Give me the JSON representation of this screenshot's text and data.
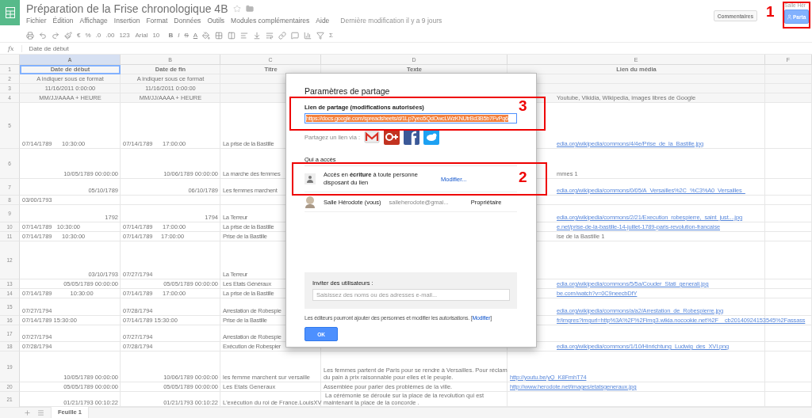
{
  "app": {
    "title": "Préparation de la Frise chronologique 4B",
    "menu": [
      "Fichier",
      "Édition",
      "Affichage",
      "Insertion",
      "Format",
      "Données",
      "Outils",
      "Modules complémentaires",
      "Aide"
    ],
    "last_modified": "Dernière modification il y a 9 jours",
    "user": "Salle Hér",
    "comments_button": "Commentaires",
    "share_button": "Parta"
  },
  "toolbar": [
    {
      "kind": "print"
    },
    {
      "kind": "undo"
    },
    {
      "kind": "redo"
    },
    {
      "kind": "paint"
    },
    {
      "kind": "text",
      "label": "€"
    },
    {
      "kind": "text",
      "label": "%"
    },
    {
      "kind": "text",
      "label": ".0"
    },
    {
      "kind": "text",
      "label": ".00"
    },
    {
      "kind": "menu",
      "label": "123"
    },
    {
      "kind": "menu",
      "label": "Arial"
    },
    {
      "kind": "menu",
      "label": "10"
    },
    {
      "kind": "bold",
      "label": "B"
    },
    {
      "kind": "italic",
      "label": "I"
    },
    {
      "kind": "strike",
      "label": "S"
    },
    {
      "kind": "color",
      "label": "A"
    },
    {
      "kind": "fill"
    },
    {
      "kind": "borders"
    },
    {
      "kind": "merge"
    },
    {
      "kind": "align"
    },
    {
      "kind": "valign"
    },
    {
      "kind": "wrap"
    },
    {
      "kind": "link"
    },
    {
      "kind": "comment"
    },
    {
      "kind": "chart"
    },
    {
      "kind": "filter"
    },
    {
      "kind": "menu",
      "label": "Σ"
    }
  ],
  "formula_bar": {
    "label": "fx",
    "value": "Date de début"
  },
  "grid": {
    "columns": [
      {
        "label": "A",
        "selected": true
      },
      {
        "label": "B",
        "selected": false
      },
      {
        "label": "C",
        "selected": false
      },
      {
        "label": "D",
        "selected": false
      },
      {
        "label": "E",
        "selected": false
      },
      {
        "label": "F",
        "selected": false
      }
    ],
    "rows": [
      {
        "number": "1",
        "a": "Date de début",
        "b": "Date de fin",
        "c": "Titre",
        "d": "Texte",
        "e": "Lien du média"
      },
      {
        "number": "2",
        "a": "A indiquer sous ce format",
        "b": "A indiquer sous ce format"
      },
      {
        "number": "3",
        "a": "11/16/2011 0:00:00",
        "b": "11/16/2011 0:00:00"
      },
      {
        "number": "4",
        "a": "MM/JJ/AAAA + HEURE",
        "b": "MM/JJ/AAAA + HEURE",
        "e": "Youtube, Vikidia, Wikipedia, images libres de Google"
      },
      {
        "number": "5",
        "a": "07/14/1789      10:30:00",
        "b": "07/14/1789      17:00:00",
        "c": "La prise de la Bastille",
        "link": "edia.org/wikipedia/commons/4/4e/Prise_de_la_Bastille.jpg"
      },
      {
        "number": "6",
        "a": "10/05/1789 00:00:00",
        "b": "10/06/1789 00:00:00",
        "c": "La marche des femmes",
        "e": "mmes 1"
      },
      {
        "number": "7",
        "a": "05/10/1789",
        "b": "06/10/1789",
        "c": "Les femmes marchent",
        "link": "edia.org/wikipedia/commons/0/05/A_Versailles%2C_%C3%A0_Versailles_"
      },
      {
        "number": "8",
        "a": "03/00/1793"
      },
      {
        "number": "9",
        "a": "1792",
        "b": "1794",
        "c": "La Terreur",
        "link": "edia.org/wikipedia/commons/2/21/Execution_robespierre,_saint_just....jpg"
      },
      {
        "number": "10",
        "a": "07/14/1789   10:30:00",
        "b": "07/14/1789      17:00:00",
        "c": "La prise de la Bastille",
        "link": "e.net/prise-de-la-bastille-14-juillet-1789-paris-revolution-francaise"
      },
      {
        "number": "11",
        "a": "07/14/1789      10:30:00",
        "b": "07/14/1789     17:00:00",
        "c": "Prise de la Bastille",
        "e": "ise de la Bastille 1"
      },
      {
        "number": "12",
        "a": "03/10/1793",
        "b": "07/27/1794",
        "c": "La Terreur"
      },
      {
        "number": "13",
        "a": "05/05/1789 00:00:00",
        "b": "05/05/1789 00:00:00",
        "c": "Les Etats Généraux",
        "link": "edia.org/wikipedia/commons/5/5a/Couder_Stati_generali.jpg"
      },
      {
        "number": "14",
        "a": "07/14/1789           10:30:00",
        "b": "07/14/1789      17:00:00",
        "c": "La prise de la Bastille",
        "link": "be.com/watch?v=0C9neecbDfY"
      },
      {
        "number": "15",
        "a": "07/27/1794",
        "b": "07/28/1794",
        "c": "Arrestation de Robespie",
        "link": "edia.org/wikipedia/commons/a/a2/Arrestation_de_Robespierre.jpg"
      },
      {
        "number": "16",
        "a": "07/14/1789 15:30:00",
        "b": "07/14/1789 15:30:00",
        "c": "Prise de la Bastille",
        "link": "fr/imgres?imgurl=http%3A%2F%2Fimg3.wikia.nocookie.net%2F__cb20140924153545%2Fassass"
      },
      {
        "number": "17",
        "a": "07/27/1794",
        "b": "07/27/1794",
        "c": "Arrestation de Robespie"
      },
      {
        "number": "18",
        "a": "07/28/1794",
        "b": "07/28/1794",
        "c": "Exécution de Robespier",
        "link": "edia.org/wikipedia/commons/1/10/Hinrichtung_Ludwig_des_XVI.png"
      },
      {
        "number": "19",
        "a": "10/05/1789 00:00:00",
        "b": "10/06/1789 00:00:00",
        "c": "les femme marchent sur versaille",
        "d": "Les femmes partent de Paris pour se rendre à Versailles. Pour réclam\ndu pain à prix raisonnable pour elles et le peuple.",
        "link": "http://youtu.be/yQ_K8FmhT74"
      },
      {
        "number": "20",
        "a": "05/05/1789 00:00:00",
        "b": "05/05/1789 00:00:00",
        "c": "Les Etats Generaux",
        "d": "Assemblée pour parler des problèmes de la ville.",
        "link": "http://www.herodote.net/images/etatsgeneraux.jpg"
      },
      {
        "number": "21",
        "a": "01/21/1793 00:10:22",
        "b": "01/21/1793 00:10:22",
        "c": "L'exécution du roi de France.LouisXV",
        "d": " La cérémonie se déroule sur la place de la revolution qui est\nmaintenant la place de la concorde ."
      }
    ]
  },
  "sheet_tabs": [
    {
      "label": "Feuille 1",
      "selected": true
    }
  ],
  "dialog": {
    "title": "Paramètres de partage",
    "link_label": "Lien de partage (modifications autorisées)",
    "link_value": "https://docs.google.com/spreadsheets/d/1Lp7yeo5QdOwcLWzKNUtrBd3B5b7FvPq6",
    "share_via": "Partagez un lien via :",
    "share_services": [
      {
        "kind": "gmail"
      },
      {
        "kind": "gplus"
      },
      {
        "kind": "facebook"
      },
      {
        "kind": "twitter"
      }
    ],
    "access_heading": "Qui a accès",
    "access": [
      {
        "kind": "link",
        "text": "Accès en **écriture** à toute personne disposant du lien",
        "action": "Modifier..."
      },
      {
        "kind": "person",
        "name": "Salle Hérodote (vous)",
        "email": "salleherodote@gmai...",
        "role": "Propriétaire"
      }
    ],
    "invite_label": "Inviter des utilisateurs :",
    "invite_placeholder": "Saisissez des noms ou des adresses e-mail...",
    "note": "Les éditeurs pourront ajouter des personnes et modifier les autorisations.",
    "note_open": "[",
    "note_link": "Modifier",
    "note_close": "]",
    "ok_button": "OK"
  },
  "annotations": [
    {
      "number": "1"
    },
    {
      "number": "2"
    },
    {
      "number": "3"
    }
  ]
}
